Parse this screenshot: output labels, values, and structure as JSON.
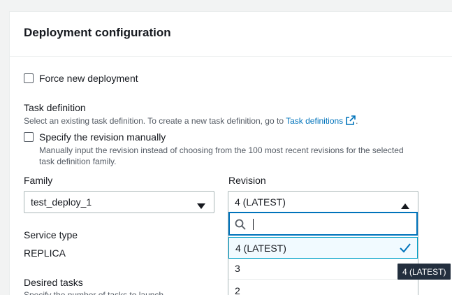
{
  "panel": {
    "title": "Deployment configuration"
  },
  "force_deploy": {
    "label": "Force new deployment"
  },
  "task_def": {
    "label": "Task definition",
    "desc_prefix": "Select an existing task definition. To create a new task definition, go to ",
    "link": "Task definitions",
    "desc_suffix": "."
  },
  "revision_manual": {
    "label": "Specify the revision manually",
    "desc_line1": "Manually input the revision instead of choosing from the 100 most recent revisions for the selected",
    "desc_line2": "task definition family."
  },
  "family": {
    "label": "Family",
    "value": "test_deploy_1"
  },
  "revision": {
    "label": "Revision",
    "value": "4 (LATEST)",
    "search_value": "",
    "options": [
      "4 (LATEST)",
      "3",
      "2"
    ],
    "selected": "4 (LATEST)"
  },
  "service_type": {
    "label": "Service type",
    "value": "REPLICA"
  },
  "desired_tasks": {
    "label": "Desired tasks",
    "desc": "Specify the number of tasks to launch"
  },
  "tooltip": {
    "text": "4 (LATEST)"
  },
  "colors": {
    "accent": "#0073bb",
    "selected_bg": "#f1faff",
    "tooltip_bg": "#232f3e"
  },
  "icons": [
    "external-link-icon",
    "caret-down-icon",
    "caret-up-icon",
    "search-icon",
    "checkmark-icon"
  ]
}
